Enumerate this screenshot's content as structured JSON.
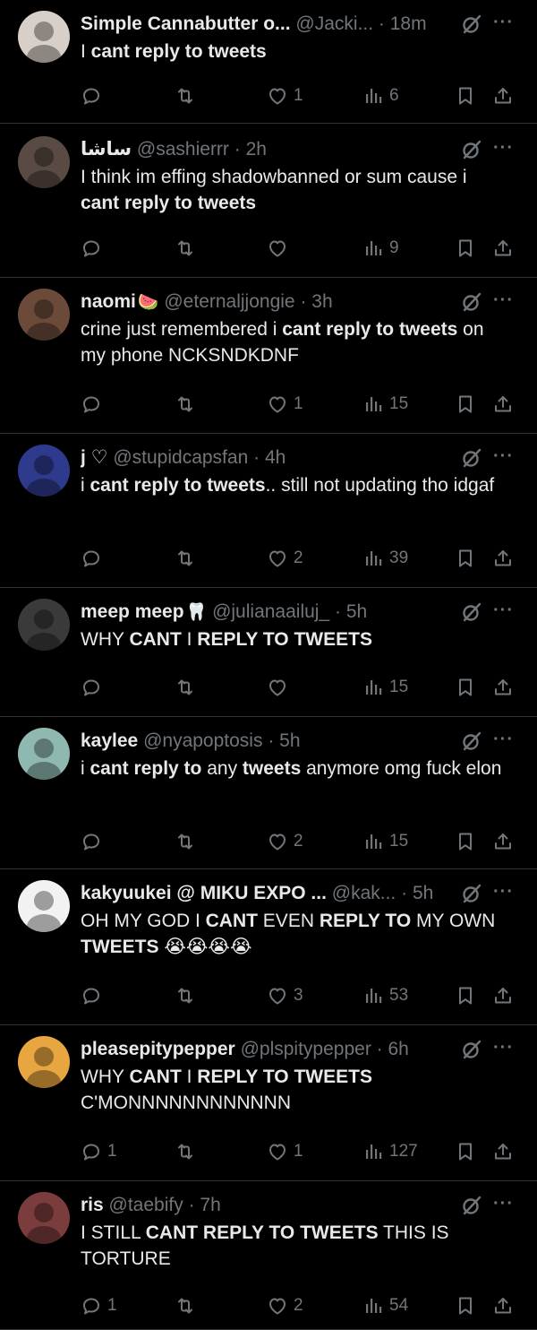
{
  "tweets": [
    {
      "name": "Simple Cannabutter o...",
      "handle": "@Jacki...",
      "time": "18m",
      "name_emoji": "",
      "body": [
        {
          "t": "I ",
          "b": false
        },
        {
          "t": "cant reply to tweets",
          "b": true
        }
      ],
      "replies": "",
      "likes": "1",
      "views": "6",
      "avatar_color": "#d8d0c8"
    },
    {
      "name": "ساشا",
      "handle": "@sashierrr",
      "time": "2h",
      "name_emoji": "",
      "body": [
        {
          "t": "I think im effing shadowbanned or sum cause i ",
          "b": false
        },
        {
          "t": "cant reply to tweets",
          "b": true
        }
      ],
      "replies": "",
      "likes": "",
      "views": "9",
      "avatar_color": "#5a4a44"
    },
    {
      "name": "naomi",
      "handle": "@eternaljjongie",
      "time": "3h",
      "name_emoji": "🍉",
      "body": [
        {
          "t": "crine just remembered i ",
          "b": false
        },
        {
          "t": "cant reply to tweets",
          "b": true
        },
        {
          "t": " on my phone NCKSNDKDNF",
          "b": false
        }
      ],
      "replies": "",
      "likes": "1",
      "views": "15",
      "avatar_color": "#6b4a3a"
    },
    {
      "name": "j ♡",
      "handle": "@stupidcapsfan",
      "time": "4h",
      "name_emoji": "",
      "body": [
        {
          "t": "i ",
          "b": false
        },
        {
          "t": "cant reply to tweets",
          "b": true
        },
        {
          "t": ".. still not updating tho idgaf",
          "b": false
        }
      ],
      "replies": "",
      "likes": "2",
      "views": "39",
      "avatar_color": "#2e3a8c"
    },
    {
      "name": "meep meep",
      "handle": "@julianaailuj_",
      "time": "5h",
      "name_emoji": "🦷",
      "body": [
        {
          "t": "WHY ",
          "b": false
        },
        {
          "t": "CANT",
          "b": true
        },
        {
          "t": " I ",
          "b": false
        },
        {
          "t": "REPLY TO TWEETS",
          "b": true
        }
      ],
      "replies": "",
      "likes": "",
      "views": "15",
      "avatar_color": "#3a3a3a"
    },
    {
      "name": "kaylee",
      "handle": "@nyapoptosis",
      "time": "5h",
      "name_emoji": "",
      "body": [
        {
          "t": "i ",
          "b": false
        },
        {
          "t": "cant reply to",
          "b": true
        },
        {
          "t": " any ",
          "b": false
        },
        {
          "t": "tweets",
          "b": true
        },
        {
          "t": " anymore omg fuck elon",
          "b": false
        }
      ],
      "replies": "",
      "likes": "2",
      "views": "15",
      "avatar_color": "#8fb8b0"
    },
    {
      "name": "kakyuukei @ MIKU EXPO ...",
      "handle": "@kak...",
      "time": "5h",
      "name_emoji": "",
      "body": [
        {
          "t": "OH MY GOD I ",
          "b": false
        },
        {
          "t": "CANT",
          "b": true
        },
        {
          "t": " EVEN ",
          "b": false
        },
        {
          "t": "REPLY TO",
          "b": true
        },
        {
          "t": " MY OWN ",
          "b": false
        },
        {
          "t": "TWEETS",
          "b": true
        },
        {
          "t": " 😭😭😭😭",
          "b": false
        }
      ],
      "replies": "",
      "likes": "3",
      "views": "53",
      "avatar_color": "#f2f2f2"
    },
    {
      "name": "pleasepitypepper",
      "handle": "@plspitypepper",
      "time": "6h",
      "name_emoji": "",
      "body": [
        {
          "t": "WHY ",
          "b": false
        },
        {
          "t": "CANT",
          "b": true
        },
        {
          "t": " I ",
          "b": false
        },
        {
          "t": "REPLY TO TWEETS",
          "b": true
        },
        {
          "t": " C'MONNNNNNNNNNNN",
          "b": false
        }
      ],
      "replies": "1",
      "likes": "1",
      "views": "127",
      "avatar_color": "#e8a640"
    },
    {
      "name": "ris",
      "handle": "@taebify",
      "time": "7h",
      "name_emoji": "",
      "body": [
        {
          "t": "I STILL ",
          "b": false
        },
        {
          "t": "CANT REPLY TO TWEETS",
          "b": true
        },
        {
          "t": " THIS IS TORTURE",
          "b": false
        }
      ],
      "replies": "1",
      "likes": "2",
      "views": "54",
      "avatar_color": "#7a3c3c"
    }
  ]
}
